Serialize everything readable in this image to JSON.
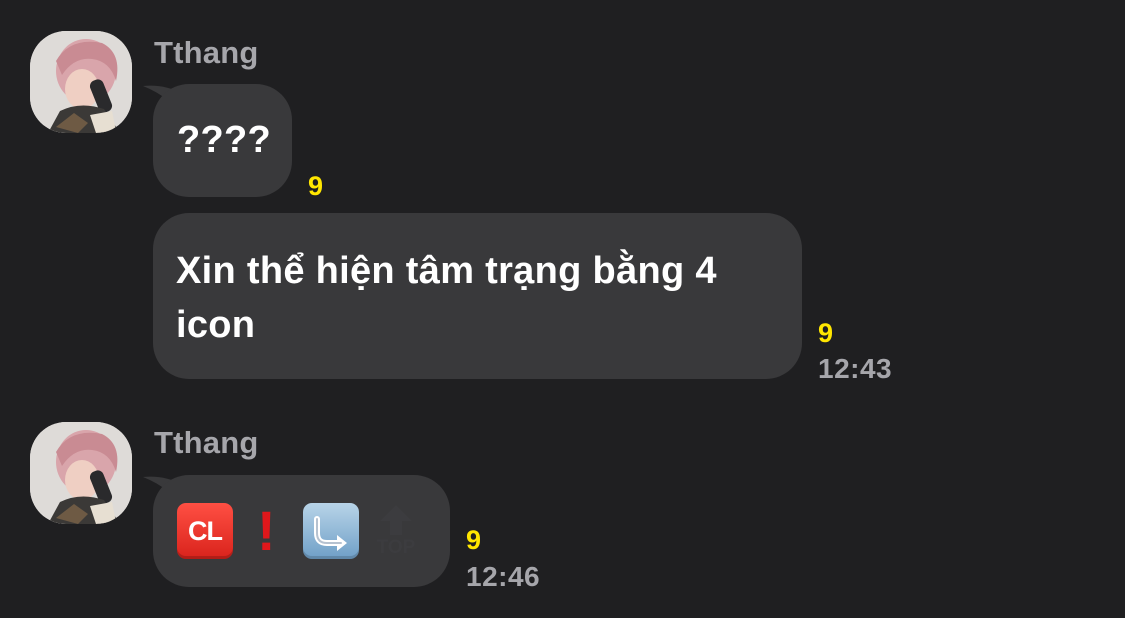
{
  "messages": [
    {
      "sender": "Tthang",
      "bubbles": [
        {
          "text": "????",
          "unread": "9",
          "time": ""
        },
        {
          "text": "Xin thể hiện tâm trạng bằng 4 icon",
          "unread": "9",
          "time": "12:43"
        }
      ]
    },
    {
      "sender": "Tthang",
      "bubbles": [
        {
          "emojis": [
            {
              "icon": "cl-button-icon",
              "text": "CL"
            },
            {
              "icon": "exclamation-icon",
              "text": "!"
            },
            {
              "icon": "right-arrow-curving-left-icon"
            },
            {
              "icon": "top-arrow-icon",
              "text": "TOP"
            }
          ],
          "unread": "9",
          "time": "12:46"
        }
      ]
    }
  ],
  "colors": {
    "background": "#1f1f21",
    "bubble": "#39393b",
    "unread": "#ffe600",
    "meta": "#a6a6ab"
  }
}
